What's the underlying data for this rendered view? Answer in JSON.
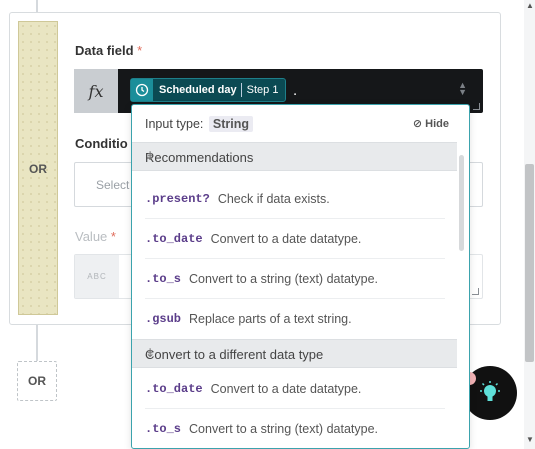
{
  "rule_card": {
    "or_label": "OR",
    "data_field": {
      "label": "Data field",
      "required_mark": "*",
      "formula_icon": "fx-icon",
      "pill_name": "Scheduled day",
      "pill_step": "Step 1",
      "typed_suffix": "."
    },
    "condition": {
      "label": "Conditio",
      "placeholder": "Select"
    },
    "value": {
      "label": "Value",
      "required_mark": "*",
      "type_badge": "ABC"
    }
  },
  "add_or_label": "OR",
  "dropdown": {
    "input_type_label": "Input type:",
    "input_type_value": "String",
    "hide_label": "Hide",
    "sections": [
      {
        "title": "Recommendations",
        "items": [
          {
            "method": ".present?",
            "description": "Check if data exists."
          },
          {
            "method": ".to_date",
            "description": "Convert to a date datatype."
          },
          {
            "method": ".to_s",
            "description": "Convert to a string (text) datatype."
          },
          {
            "method": ".gsub",
            "description": "Replace parts of a text string."
          }
        ]
      },
      {
        "title": "Convert to a different data type",
        "items": [
          {
            "method": ".to_date",
            "description": "Convert to a date datatype."
          },
          {
            "method": ".to_s",
            "description": "Convert to a string (text) datatype."
          }
        ]
      }
    ]
  },
  "colors": {
    "accent_teal": "#1b8e9a",
    "or_bar": "#e9e5c2",
    "method_purple": "#5b3d8a"
  },
  "icons": {
    "clock": "clock-icon",
    "hide": "eye-slash-icon",
    "collapse": "collapse-icon",
    "help": "lightbulb-icon"
  }
}
